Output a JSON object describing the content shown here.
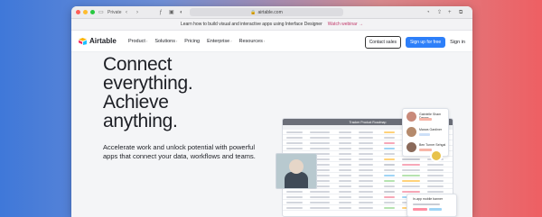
{
  "browser": {
    "private_label": "Private",
    "url": "airtable.com",
    "icons": [
      "sidebar-icon",
      "back-icon",
      "forward-icon",
      "translate-icon",
      "reader-icon",
      "privacy-icon",
      "lock-icon",
      "download-icon",
      "share-icon",
      "new-tab-icon",
      "tabs-icon"
    ]
  },
  "announcement": {
    "text": "Learn how to build visual and interactive apps using Interface Designer",
    "link": "Watch webinar →"
  },
  "nav": {
    "logo_text": "Airtable",
    "items": [
      "Product",
      "Solutions",
      "Pricing",
      "Enterprise",
      "Resources"
    ],
    "contact_sales": "Contact sales",
    "signup": "Sign up for free",
    "signin": "Sign in"
  },
  "hero": {
    "headline_lines": [
      "Connect",
      "everything.",
      "Achieve",
      "anything."
    ],
    "subhead": "Accelerate work and unlock potential with powerful apps that connect your data, workflows and teams."
  },
  "mock": {
    "window_title": "Tracker Product Roadmap",
    "card_a_names": [
      "Gabrielle Sham Dawes",
      "Marwa Gardiner",
      "Ben Turner Sehgal"
    ],
    "card_b_title": "In-app mobile banner"
  },
  "colors": {
    "accent": "#2d7ff9",
    "link": "#c23b6b",
    "headline": "#1d1f25"
  }
}
